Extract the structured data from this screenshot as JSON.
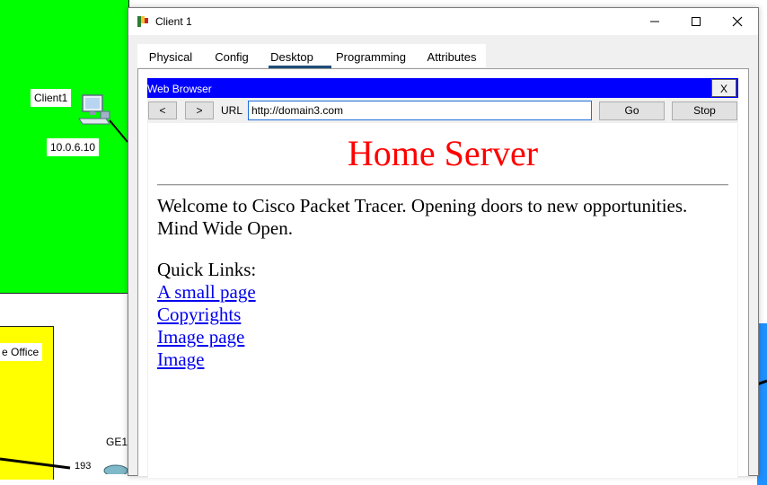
{
  "background": {
    "client_label": "Client1",
    "client_ip": "10.0.6.10",
    "office_label": "e Office",
    "interface_label": "GE1",
    "number_label": "193",
    "colors": {
      "green_zone": "#00ff00",
      "yellow_zone": "#ffff00",
      "blue_zone": "#1e90ff"
    }
  },
  "window": {
    "title": "Client 1",
    "controls": {
      "minimize_icon": "minimize-icon",
      "maximize_icon": "maximize-icon",
      "close_icon": "close-icon"
    },
    "tabs": [
      {
        "label": "Physical"
      },
      {
        "label": "Config"
      },
      {
        "label": "Desktop",
        "active": true
      },
      {
        "label": "Programming"
      },
      {
        "label": "Attributes"
      }
    ]
  },
  "browser": {
    "title": "Web Browser",
    "close_label": "X",
    "back_label": "<",
    "forward_label": ">",
    "url_label": "URL",
    "url_value": "http://domain3.com",
    "go_label": "Go",
    "stop_label": "Stop",
    "colors": {
      "title_bar": "#0000ff",
      "heading": "#ff0000",
      "link": "#0000ee"
    }
  },
  "page": {
    "heading": "Home Server",
    "welcome": "Welcome to Cisco Packet Tracer. Opening doors to new opportunities. Mind Wide Open.",
    "quick_links_label": "Quick Links:",
    "links": [
      "A small page",
      "Copyrights",
      "Image page",
      "Image"
    ]
  }
}
